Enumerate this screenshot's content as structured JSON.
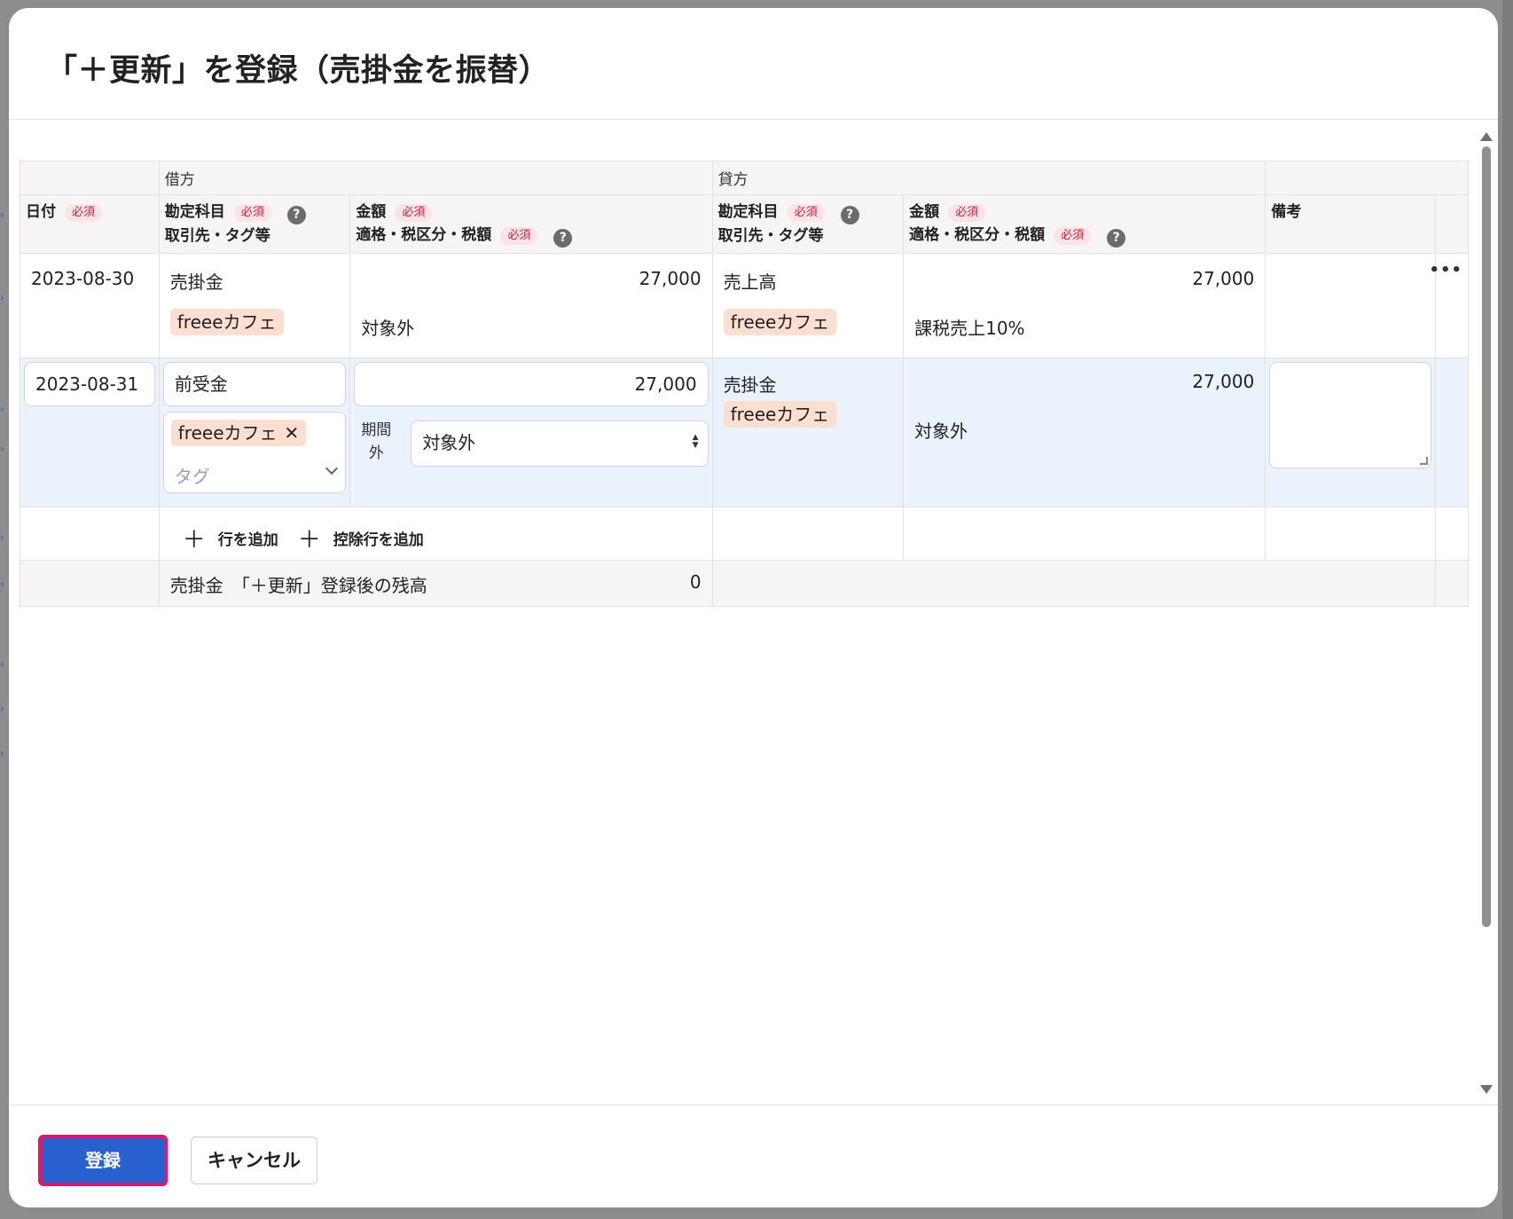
{
  "title": "「＋更新」を登録（売掛金を振替）",
  "table": {
    "group_debit": "借方",
    "group_credit": "貸方",
    "required": "必須",
    "col_date": "日付",
    "col_account": "勘定科目",
    "col_partner": "取引先・タグ等",
    "col_amount": "金額",
    "col_tax": "適格・税区分・税額",
    "col_memo": "備考",
    "help_glyph": "?"
  },
  "row1": {
    "date": "2023-08-30",
    "debit_account": "売掛金",
    "debit_tag": "freeeカフェ",
    "debit_amount": "27,000",
    "debit_tax": "対象外",
    "credit_account": "売上高",
    "credit_tag": "freeeカフェ",
    "credit_amount": "27,000",
    "credit_tax": "課税売上10%",
    "menu": "•••"
  },
  "row2": {
    "date": "2023-08-31",
    "debit_account": "前受金",
    "debit_tag": "freeeカフェ",
    "tag_remove": "✕",
    "tag_placeholder": "タグ",
    "debit_amount": "27,000",
    "period_label_1": "期間",
    "period_label_2": "外",
    "debit_tax": "対象外",
    "credit_account": "売掛金",
    "credit_tag": "freeeカフェ",
    "credit_amount": "27,000",
    "credit_tax": "対象外",
    "memo": ""
  },
  "actions": {
    "add_row": "行を追加",
    "add_deduction_row": "控除行を追加",
    "plus": "＋"
  },
  "balance": {
    "label": "売掛金　「＋更新」登録後の残高",
    "value": "0"
  },
  "footer": {
    "submit": "登録",
    "cancel": "キャンセル"
  },
  "colors": {
    "primary": "#2960d0",
    "highlight_border": "#e8126b",
    "tag_bg": "#fcdfd0",
    "required_bg": "#fbe3e6",
    "required_text": "#c4213b",
    "active_row_bg": "#eaf2fc"
  }
}
